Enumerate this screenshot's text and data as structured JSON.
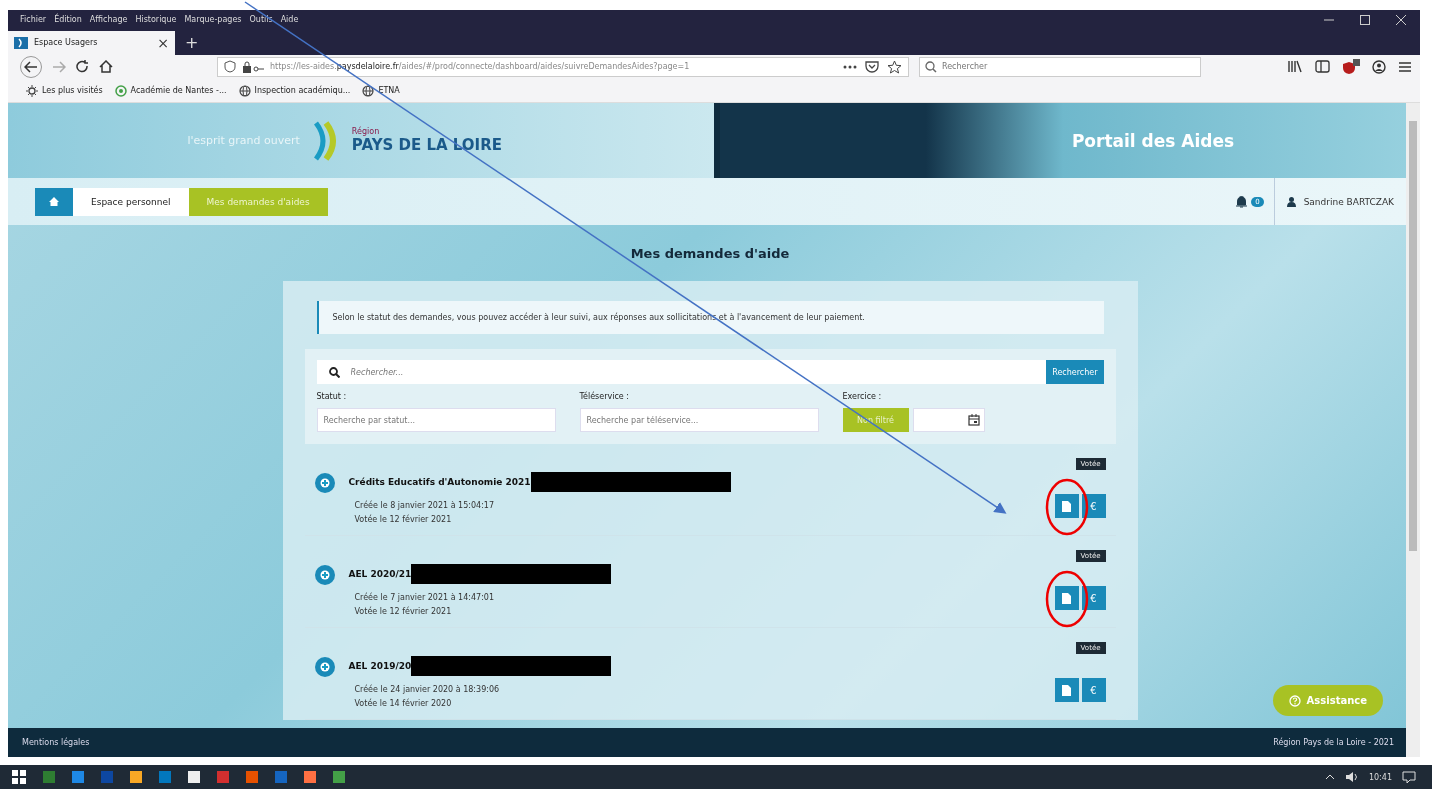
{
  "browser": {
    "menu": [
      "Fichier",
      "Édition",
      "Affichage",
      "Historique",
      "Marque-pages",
      "Outils",
      "Aide"
    ],
    "tab": {
      "title": "Espace Usagers",
      "close": "×"
    },
    "new_tab": "+",
    "url": "https://les-aides.**paysdelaloire.fr**/aides/#/prod/connecte/dashboard/aides/suivreDemandesAides?page=1",
    "search_placeholder": "Rechercher",
    "bookmarks": [
      "Les plus visités",
      "Académie de Nantes -...",
      "Inspection académiqu...",
      "ETNA"
    ]
  },
  "site": {
    "tagline": "l'esprit grand ouvert",
    "logo_small": "Région",
    "logo": "PAYS DE LA LOIRE",
    "portal_title": "Portail des Aides"
  },
  "breadcrumb": [
    {
      "label": "Espace personnel",
      "selected": false
    },
    {
      "label": "Mes demandes d'aides",
      "selected": true
    }
  ],
  "notifications": {
    "count": "0"
  },
  "user": "Sandrine BARTCZAK",
  "page_title": "Mes demandes d'aide",
  "info": "Selon le statut des demandes, vous pouvez accéder à leur suivi, aux réponses aux sollicitations et à l'avancement de leur paiement.",
  "search": {
    "placeholder": "Rechercher...",
    "button": "Rechercher"
  },
  "filters": [
    {
      "label": "Statut :",
      "placeholder": "Recherche par statut..."
    },
    {
      "label": "Téléservice :",
      "placeholder": "Recherche par téléservice..."
    }
  ],
  "exercice": {
    "label": "Exercice :",
    "button": "Non filtré"
  },
  "requests": [
    {
      "title": "Crédits Educatifs d'Autonomie 2021",
      "redacted": true,
      "created": "Créée le 8 janvier 2021 à 15:04:17",
      "voted": "Votée le 12 février 2021",
      "status": "Votée",
      "circled": true
    },
    {
      "title": "AEL 2020/21",
      "redacted": true,
      "created": "Créée le 7 janvier 2021 à 14:47:01",
      "voted": "Votée le 12 février 2021",
      "status": "Votée",
      "circled": true
    },
    {
      "title": "AEL 2019/20",
      "redacted": true,
      "created": "Créée le 24 janvier 2020 à 18:39:06",
      "voted": "Votée le 14 février 2020",
      "status": "Votée",
      "circled": false
    }
  ],
  "euro": "€",
  "assistance": "Assistance",
  "footer": {
    "left": "Mentions légales",
    "right": "Région Pays de la Loire - 2021"
  },
  "taskbar": {
    "time": "10:41"
  }
}
